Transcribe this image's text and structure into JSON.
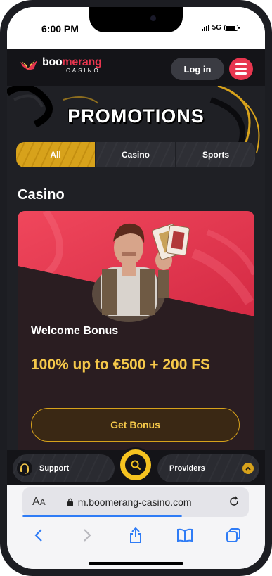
{
  "status_bar": {
    "time": "6:00 PM",
    "network": "5G"
  },
  "header": {
    "logo_brand_prefix": "boo",
    "logo_brand_highlight": "merang",
    "logo_sub": "CASINO",
    "login_label": "Log in",
    "menu_icon": "hamburger-icon"
  },
  "page": {
    "title": "PROMOTIONS",
    "tabs": [
      {
        "label": "All",
        "active": true
      },
      {
        "label": "Casino",
        "active": false
      },
      {
        "label": "Sports",
        "active": false
      }
    ],
    "section_title": "Casino"
  },
  "promo_card": {
    "title": "Welcome Bonus",
    "value": "100% up to €500 + 200 FS",
    "cta_label": "Get Bonus"
  },
  "bottom_bar": {
    "support_label": "Support",
    "providers_label": "Providers",
    "search_icon": "search-icon"
  },
  "browser": {
    "text_size_label": "A",
    "text_size_small": "A",
    "url": "m.boomerang-casino.com"
  },
  "colors": {
    "accent_gold": "#f5c84a",
    "brand_red": "#e8364f",
    "background_dark": "#1f2025",
    "ios_blue": "#2f7cf6"
  }
}
